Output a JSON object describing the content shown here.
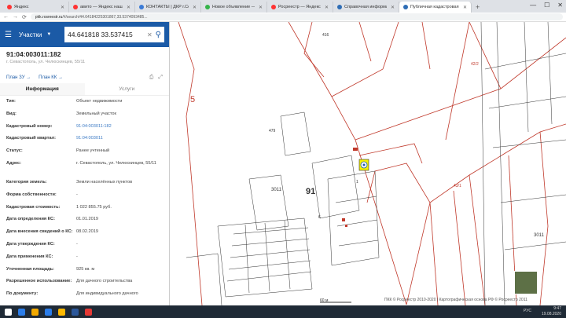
{
  "browser": {
    "tabs": [
      {
        "label": "Яндекс",
        "color": "#ff3333"
      },
      {
        "label": "авито — Яндекс нашлось",
        "color": "#ff3333"
      },
      {
        "label": "КОНТАКТЫ | ДКР г.Севасто",
        "color": "#3b7bd6"
      },
      {
        "label": "Новое объявление — Объ",
        "color": "#35b44a"
      },
      {
        "label": "Росреестр — Яндекс нашл",
        "color": "#ff3333"
      },
      {
        "label": "Справочная информация",
        "color": "#2f6db5"
      },
      {
        "label": "Публичная кадастровая",
        "color": "#2f6db5",
        "active": true
      }
    ],
    "newtab": "+",
    "url_host": "pkk.rosreestr.ru",
    "url_rest": "/#/search/44.64184225301867,33.5374093485...",
    "back": "←",
    "forward": "→",
    "reload": "⟳",
    "win_min": "—",
    "win_max": "☐",
    "win_close": "✕"
  },
  "search": {
    "type_label": "Участки",
    "query": "44.641818 33.537415"
  },
  "object": {
    "number": "91:04:003011:182",
    "address": "г. Севастополь, ул. Челюскинцев, 55/11",
    "plan_zu": "План ЗУ",
    "plan_kk": "План КК",
    "tab_info": "Информация",
    "tab_services": "Услуги"
  },
  "rows": [
    {
      "k": "Тип:",
      "v": "Объект недвижимости"
    },
    {
      "k": "Вид:",
      "v": "Земельный участок"
    },
    {
      "k": "Кадастровый номер:",
      "v": "91:04:003011:182",
      "link": true
    },
    {
      "k": "Кадастровый квартал:",
      "v": "91:04:003011",
      "link": true
    },
    {
      "k": "Статус:",
      "v": "Ранее учтенный"
    },
    {
      "k": "Адрес:",
      "v": "г. Севастополь, ул. Челюскинцев, 55/11",
      "tall": true
    },
    {
      "k": "Категория земель:",
      "v": "Земли населённых пунктов"
    },
    {
      "k": "Форма собственности:",
      "v": "-"
    },
    {
      "k": "Кадастровая стоимость:",
      "v": "1 022 855.75 руб."
    },
    {
      "k": "Дата определения КС:",
      "v": "01.01.2019"
    },
    {
      "k": "Дата внесения сведений о КС:",
      "v": "08.02.2019"
    },
    {
      "k": "Дата утверждения КС:",
      "v": "-"
    },
    {
      "k": "Дата применения КС:",
      "v": "-"
    },
    {
      "k": "Уточненная площадь:",
      "v": "925 кв. м"
    },
    {
      "k": "Разрешенное использование:",
      "v": "Для дачного строительства"
    },
    {
      "k": "По документу:",
      "v": "Для индивидуального дачного"
    }
  ],
  "map": {
    "labels": {
      "l5": "5",
      "l91": "91",
      "l3011a": "3011",
      "l3011b": "3011",
      "l416": "416",
      "l42": "42/2",
      "l43": "43/1",
      "l479": "479",
      "l6": "6",
      "l1": "1"
    },
    "scale": "60 м",
    "copyright": "ПКК © Росреестр 2010-2020 | Картографическая основа РФ © Росреестр 2011"
  },
  "taskbar": {
    "lang": "РУС",
    "time": "9:47",
    "date": "19.08.2020"
  }
}
